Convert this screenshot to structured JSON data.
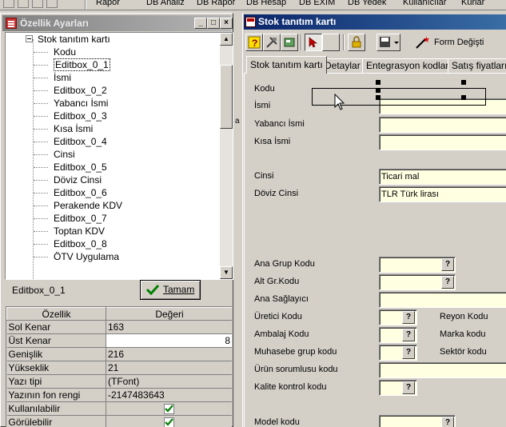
{
  "menubar": {
    "items": [
      {
        "label": "Rapor",
        "underline": "R"
      },
      {
        "label": "DB Analiz",
        "underline": "A"
      },
      {
        "label": "DB Rapor",
        "underline": "R"
      },
      {
        "label": "DB Hesap",
        "underline": "H"
      },
      {
        "label": "DB EXIM",
        "underline": "X"
      },
      {
        "label": "DB Yedek",
        "underline": "Y"
      },
      {
        "label": "Kullanıcılar",
        "underline": "K"
      },
      {
        "label": "Kurlar",
        "underline": "u"
      }
    ]
  },
  "properties_panel": {
    "title": "Özellik Ayarları",
    "caption_buttons": {
      "minimize": "_",
      "maximize": "□",
      "close": "×"
    },
    "tree": {
      "root": "Stok tanıtım kartı",
      "children": [
        "Kodu",
        "Editbox_0_1",
        "İsmi",
        "Editbox_0_2",
        "Yabancı İsmi",
        "Editbox_0_3",
        "Kısa İsmi",
        "Editbox_0_4",
        "Cinsi",
        "Editbox_0_5",
        "Döviz Cinsi",
        "Editbox_0_6",
        "Perakende KDV",
        "Editbox_0_7",
        "Toptan KDV",
        "Editbox_0_8",
        "ÖTV Uygulama"
      ],
      "selected": "Editbox_0_1"
    },
    "selected_component": "Editbox_0_1",
    "ok_button": "Tamam",
    "grid": {
      "headers": [
        "Özellik",
        "Değeri"
      ],
      "rows": [
        {
          "name": "Sol Kenar",
          "value": "163"
        },
        {
          "name": "Üst Kenar",
          "value": "8"
        },
        {
          "name": "Genişlik",
          "value": "216"
        },
        {
          "name": "Yükseklik",
          "value": "21"
        },
        {
          "name": "Yazı tipi",
          "value": "(TFont)"
        },
        {
          "name": "Yazının fon rengi",
          "value": "-2147483643"
        },
        {
          "name": "Kullanılabilir",
          "value": ""
        },
        {
          "name": "Görülebilir",
          "value": ""
        }
      ]
    }
  },
  "stock_window": {
    "title": "Stok tanıtım kartı",
    "toolbar": {
      "form_changed_label": "Form Değişti"
    },
    "tabs": [
      "Stok tanıtım kartı",
      "Detaylar",
      "Entegrasyon kodları",
      "Satış fiyatları"
    ],
    "active_tab": "Stok tanıtım kartı",
    "fields": {
      "kodu": {
        "label": "Kodu",
        "value": ""
      },
      "ismi": {
        "label": "İsmi",
        "value": ""
      },
      "yabanci_ismi": {
        "label": "Yabancı İsmi",
        "value": ""
      },
      "kisa_ismi": {
        "label": "Kısa İsmi",
        "value": ""
      },
      "cinsi": {
        "label": "Cinsi",
        "value": "Ticari mal"
      },
      "doviz_cinsi": {
        "label": "Döviz Cinsi",
        "value": "TLR Türk lirası"
      },
      "ana_grup_kodu": {
        "label": "Ana Grup Kodu",
        "value": ""
      },
      "alt_gr_kodu": {
        "label": "Alt Gr.Kodu",
        "value": ""
      },
      "ana_saglayici": {
        "label": "Ana Sağlayıcı",
        "value": ""
      },
      "uretici_kodu": {
        "label": "Üretici Kodu",
        "value": ""
      },
      "ambalaj_kodu": {
        "label": "Ambalaj Kodu",
        "value": ""
      },
      "muhasebe_grup_kodu": {
        "label": "Muhasebe grup kodu",
        "value": ""
      },
      "urun_sorumlusu_kodu": {
        "label": "Ürün sorumlusu kodu",
        "value": ""
      },
      "kalite_kontrol_kodu": {
        "label": "Kalite kontrol kodu",
        "value": ""
      },
      "model_kodu": {
        "label": "Model kodu",
        "value": ""
      },
      "reyon_kodu": {
        "label": "Reyon Kodu"
      },
      "marka_kodu": {
        "label": "Marka kodu"
      },
      "sektor_kodu": {
        "label": "Sektör kodu"
      }
    },
    "lookup_button": "?"
  },
  "splitter_glyph": "a"
}
